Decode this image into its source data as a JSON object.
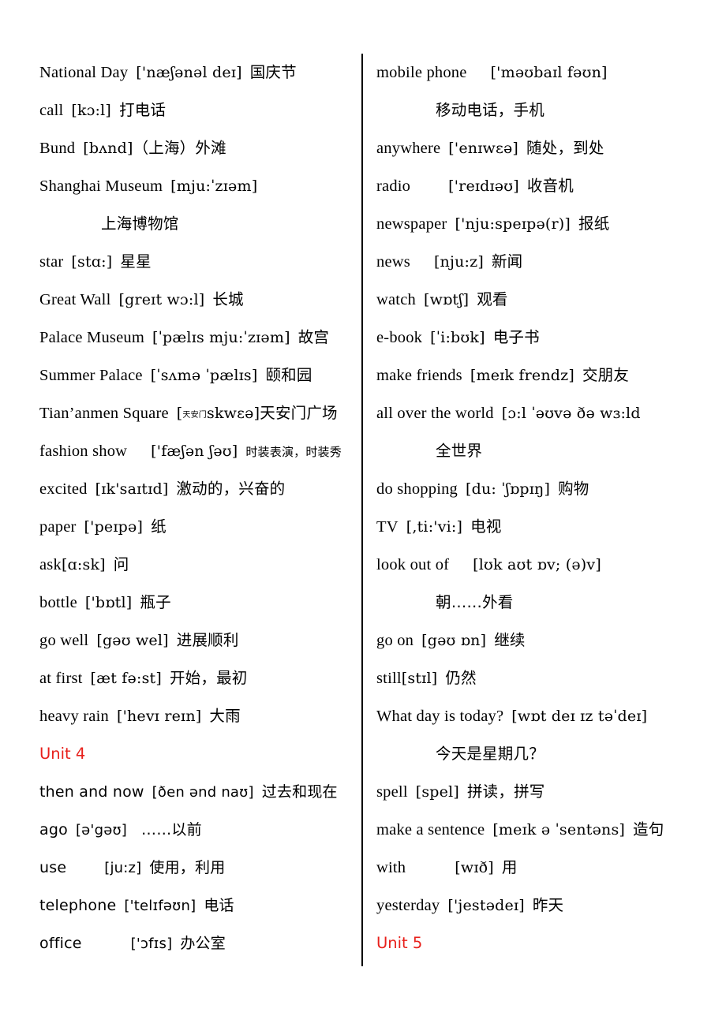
{
  "document": {
    "type": "vocabulary-list",
    "title": "English-Chinese Vocabulary List",
    "accent_color": "#e8201b",
    "text_color": "#000000",
    "background_color": "#ffffff",
    "columns": 2,
    "divider": "vertical-rule"
  },
  "left_column": {
    "entries": [
      {
        "word": "National  Day",
        "gap": "  ",
        "ipa": "['næʃənəl  deɪ]",
        "zh": "国庆节"
      },
      {
        "word": "call",
        "gap": "  ",
        "ipa": "[kɔ:l]",
        "zh": "打电话"
      },
      {
        "word": "Bund",
        "gap": " ",
        "ipa": "[bʌnd]",
        "zh": "（上海）外滩"
      },
      {
        "word": "Shanghai  Museum",
        "gap": "  ",
        "ipa": "[mju:ˈzɪəm]",
        "zh": ""
      },
      {
        "word": "",
        "ipa": "",
        "zh": "上海博物馆",
        "indent": true
      },
      {
        "word": "star",
        "gap": " ",
        "ipa": "[stɑ:]",
        "zh": "星星"
      },
      {
        "word": "Great  Wall",
        "gap": " ",
        "ipa": "[greɪt  wɔ:l]",
        "zh": "长城"
      },
      {
        "word": "Palace  Museum",
        "gap": " ",
        "ipa": "[ˈpælɪs  mju:ˈzɪəm]",
        "zh": "故宫"
      },
      {
        "word": "Summer  Palace",
        "gap": " ",
        "ipa": "[ˈsʌmə  ˈpælɪs]",
        "zh": "颐和园"
      },
      {
        "word": "Tian’anmen  Square",
        "gap": " ",
        "ipa_prefix_tiny": "天安门",
        "ipa": "skwεə]",
        "ipa_open": "[",
        "zh": "天安门广场",
        "special": "tiny-cn-in-bracket"
      },
      {
        "word": "fashion  show",
        "gap": "   ",
        "ipa": "['fæʃən  ʃəʊ]",
        "zh": "时装表演，时装秀",
        "zh_small": true
      },
      {
        "word": "excited",
        "gap": " ",
        "ipa": "[ɪk'saɪtɪd]",
        "zh": "激动的，兴奋的"
      },
      {
        "word": "paper",
        "gap": " ",
        "ipa": "['peɪpə]",
        "zh": "纸"
      },
      {
        "word": "ask",
        "gap": "",
        "ipa": "[ɑ:sk]",
        "zh": "问"
      },
      {
        "word": "bottle",
        "gap": " ",
        "ipa": "['bɒtl]",
        "zh": "瓶子"
      },
      {
        "word": "go  well",
        "gap": " ",
        "ipa": "[gəʊ  wel]",
        "zh": "进展顺利"
      },
      {
        "word": "at  first",
        "gap": " ",
        "ipa": "[æt  fə:st]",
        "zh": "开始，最初"
      },
      {
        "word": "heavy  rain",
        "gap": " ",
        "ipa": "['hevɪ  reɪn]",
        "zh": "大雨"
      }
    ],
    "unit_heading": "Unit  4",
    "entries_after_unit": [
      {
        "word": "then  and  now",
        "gap": " ",
        "ipa": "[ðen  ənd  naʊ]",
        "zh": "过去和现在"
      },
      {
        "word": "ago",
        "gap": " ",
        "ipa": "[ə'gəʊ]",
        "zh": "……以前"
      },
      {
        "word": "use",
        "gap": "      ",
        "ipa": "[ju:z]",
        "zh": "使用，利用"
      },
      {
        "word": "telephone",
        "gap": " ",
        "ipa": "['telɪfəʊn]",
        "zh": "电话"
      },
      {
        "word": "office",
        "gap": "      ",
        "ipa": "['ɔfɪs]",
        "zh": "办公室"
      }
    ]
  },
  "right_column": {
    "entries": [
      {
        "word": "mobile  phone",
        "gap": "    ",
        "ipa": "['məʊbaɪl  fəʊn]",
        "zh": ""
      },
      {
        "word": "",
        "ipa": "",
        "zh": "移动电话，手机",
        "indent": true
      },
      {
        "word": "anywhere",
        "gap": " ",
        "ipa": "['enɪwεə]",
        "zh": "随处，到处"
      },
      {
        "word": "radio",
        "gap": "     ",
        "ipa": "['reɪdɪəʊ]",
        "zh": "收音机"
      },
      {
        "word": "newspaper",
        "gap": " ",
        "ipa": "['nju:speɪpə(r)]",
        "zh": "报纸"
      },
      {
        "word": "news",
        "gap": "    ",
        "ipa": "[nju:z]",
        "zh": "新闻"
      },
      {
        "word": "watch",
        "gap": " ",
        "ipa": "[wɒtʃ]",
        "zh": "观看"
      },
      {
        "word": "e-book",
        "gap": " ",
        "ipa": "[ˈi:bʊk]",
        "zh": "电子书"
      },
      {
        "word": "make  friends",
        "gap": " ",
        "ipa": "[meɪk  frendz]",
        "zh": "交朋友"
      },
      {
        "word": "all  over  the  world",
        "gap": "  ",
        "ipa": "[ɔ:l  ˈəʊvə  ðə  wɜ:ld",
        "zh": ""
      },
      {
        "word": "",
        "ipa": "",
        "zh": "全世界",
        "indent": true
      },
      {
        "word": "do  shopping",
        "gap": " ",
        "ipa": "[du:  ˈʃɒpɪŋ]",
        "zh": "购物"
      },
      {
        "word": "TV",
        "gap": "  ",
        "ipa": "[,ti:'vi:]",
        "zh": "电视"
      },
      {
        "word": "look  out  of",
        "gap": "    ",
        "ipa": "[lʊk  aʊt  ɒv;  (ə)v]",
        "zh": ""
      },
      {
        "word": "",
        "ipa": "",
        "zh": "朝……外看",
        "indent": true
      },
      {
        "word": "go  on",
        "gap": " ",
        "ipa": "[gəʊ  ɒn]",
        "zh": "继续"
      },
      {
        "word": "still",
        "gap": "",
        "ipa": "[stɪl]",
        "zh": "仍然"
      },
      {
        "word": "What  day  is  today?",
        "gap": "  ",
        "ipa": "[wɒt  deɪ  ɪz  təˈdeɪ]",
        "zh": ""
      },
      {
        "word": "",
        "ipa": "",
        "zh": "今天是星期几？",
        "indent": true
      },
      {
        "word": "spell",
        "gap": " ",
        "ipa": "[spel]",
        "zh": "拼读，拼写"
      },
      {
        "word": "make  a  sentence",
        "gap": " ",
        "ipa": "[meɪk  ə  ˈsentəns]",
        "zh": "造句"
      },
      {
        "word": "with",
        "gap": "        ",
        "ipa": "[wɪð]",
        "zh": "用"
      },
      {
        "word": "yesterday",
        "gap": " ",
        "ipa": "['jestədeɪ]",
        "zh": "昨天"
      }
    ],
    "unit_heading": "Unit  5"
  }
}
